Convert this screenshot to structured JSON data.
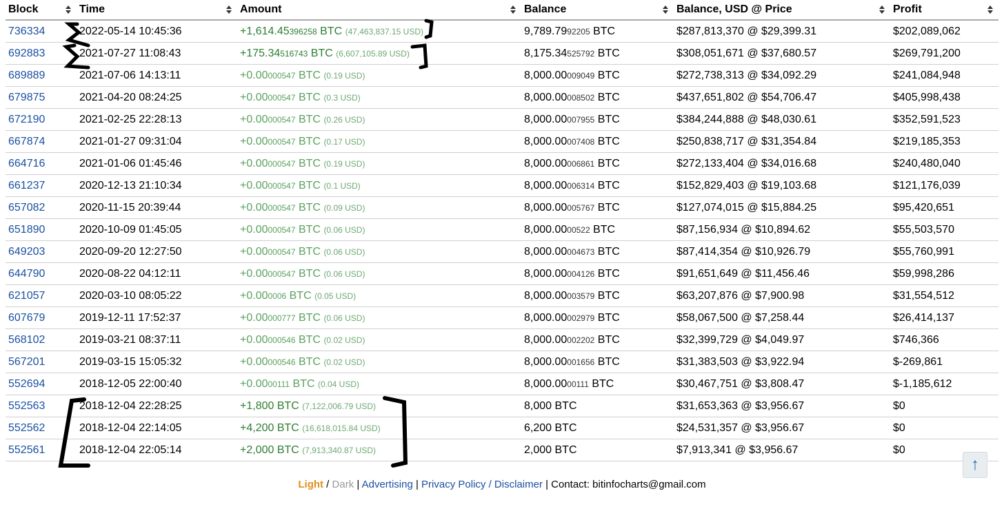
{
  "columns": [
    "Block",
    "Time",
    "Amount",
    "Balance",
    "Balance, USD @ Price",
    "Profit"
  ],
  "rows": [
    {
      "block": "736334",
      "time": "2022-05-14 10:45:36",
      "amt_main": "+1,614.45",
      "amt_frac": "396258",
      "amt_unit": " BTC",
      "amt_usd": "(47,463,837.15 USD)",
      "bal_main": "9,789.79",
      "bal_frac": "92205",
      "bal_unit": " BTC",
      "usd": "$287,813,370 @ $29,399.31",
      "profit": "$202,089,062"
    },
    {
      "block": "692883",
      "time": "2021-07-27 11:08:43",
      "amt_main": "+175.34",
      "amt_frac": "516743",
      "amt_unit": " BTC",
      "amt_usd": "(6,607,105.89 USD)",
      "bal_main": "8,175.34",
      "bal_frac": "525792",
      "bal_unit": " BTC",
      "usd": "$308,051,671 @ $37,680.57",
      "profit": "$269,791,200"
    },
    {
      "block": "689889",
      "time": "2021-07-06 14:13:11",
      "amt_main": "+0.00",
      "amt_frac": "000547",
      "amt_unit": " BTC",
      "amt_usd": "(0.19 USD)",
      "bal_main": "8,000.00",
      "bal_frac": "009049",
      "bal_unit": " BTC",
      "usd": "$272,738,313 @ $34,092.29",
      "profit": "$241,084,948"
    },
    {
      "block": "679875",
      "time": "2021-04-20 08:24:25",
      "amt_main": "+0.00",
      "amt_frac": "000547",
      "amt_unit": " BTC",
      "amt_usd": "(0.3 USD)",
      "bal_main": "8,000.00",
      "bal_frac": "008502",
      "bal_unit": " BTC",
      "usd": "$437,651,802 @ $54,706.47",
      "profit": "$405,998,438"
    },
    {
      "block": "672190",
      "time": "2021-02-25 22:28:13",
      "amt_main": "+0.00",
      "amt_frac": "000547",
      "amt_unit": " BTC",
      "amt_usd": "(0.26 USD)",
      "bal_main": "8,000.00",
      "bal_frac": "007955",
      "bal_unit": " BTC",
      "usd": "$384,244,888 @ $48,030.61",
      "profit": "$352,591,523"
    },
    {
      "block": "667874",
      "time": "2021-01-27 09:31:04",
      "amt_main": "+0.00",
      "amt_frac": "000547",
      "amt_unit": " BTC",
      "amt_usd": "(0.17 USD)",
      "bal_main": "8,000.00",
      "bal_frac": "007408",
      "bal_unit": " BTC",
      "usd": "$250,838,717 @ $31,354.84",
      "profit": "$219,185,353"
    },
    {
      "block": "664716",
      "time": "2021-01-06 01:45:46",
      "amt_main": "+0.00",
      "amt_frac": "000547",
      "amt_unit": " BTC",
      "amt_usd": "(0.19 USD)",
      "bal_main": "8,000.00",
      "bal_frac": "006861",
      "bal_unit": " BTC",
      "usd": "$272,133,404 @ $34,016.68",
      "profit": "$240,480,040"
    },
    {
      "block": "661237",
      "time": "2020-12-13 21:10:34",
      "amt_main": "+0.00",
      "amt_frac": "000547",
      "amt_unit": " BTC",
      "amt_usd": "(0.1 USD)",
      "bal_main": "8,000.00",
      "bal_frac": "006314",
      "bal_unit": " BTC",
      "usd": "$152,829,403 @ $19,103.68",
      "profit": "$121,176,039"
    },
    {
      "block": "657082",
      "time": "2020-11-15 20:39:44",
      "amt_main": "+0.00",
      "amt_frac": "000547",
      "amt_unit": " BTC",
      "amt_usd": "(0.09 USD)",
      "bal_main": "8,000.00",
      "bal_frac": "005767",
      "bal_unit": " BTC",
      "usd": "$127,074,015 @ $15,884.25",
      "profit": "$95,420,651"
    },
    {
      "block": "651890",
      "time": "2020-10-09 01:45:05",
      "amt_main": "+0.00",
      "amt_frac": "000547",
      "amt_unit": " BTC",
      "amt_usd": "(0.06 USD)",
      "bal_main": "8,000.00",
      "bal_frac": "00522",
      "bal_unit": " BTC",
      "usd": "$87,156,934 @ $10,894.62",
      "profit": "$55,503,570"
    },
    {
      "block": "649203",
      "time": "2020-09-20 12:27:50",
      "amt_main": "+0.00",
      "amt_frac": "000547",
      "amt_unit": " BTC",
      "amt_usd": "(0.06 USD)",
      "bal_main": "8,000.00",
      "bal_frac": "004673",
      "bal_unit": " BTC",
      "usd": "$87,414,354 @ $10,926.79",
      "profit": "$55,760,991"
    },
    {
      "block": "644790",
      "time": "2020-08-22 04:12:11",
      "amt_main": "+0.00",
      "amt_frac": "000547",
      "amt_unit": " BTC",
      "amt_usd": "(0.06 USD)",
      "bal_main": "8,000.00",
      "bal_frac": "004126",
      "bal_unit": " BTC",
      "usd": "$91,651,649 @ $11,456.46",
      "profit": "$59,998,286"
    },
    {
      "block": "621057",
      "time": "2020-03-10 08:05:22",
      "amt_main": "+0.00",
      "amt_frac": "0006",
      "amt_unit": " BTC",
      "amt_usd": "(0.05 USD)",
      "bal_main": "8,000.00",
      "bal_frac": "003579",
      "bal_unit": " BTC",
      "usd": "$63,207,876 @ $7,900.98",
      "profit": "$31,554,512"
    },
    {
      "block": "607679",
      "time": "2019-12-11 17:52:37",
      "amt_main": "+0.00",
      "amt_frac": "000777",
      "amt_unit": " BTC",
      "amt_usd": "(0.06 USD)",
      "bal_main": "8,000.00",
      "bal_frac": "002979",
      "bal_unit": " BTC",
      "usd": "$58,067,500 @ $7,258.44",
      "profit": "$26,414,137"
    },
    {
      "block": "568102",
      "time": "2019-03-21 08:37:11",
      "amt_main": "+0.00",
      "amt_frac": "000546",
      "amt_unit": " BTC",
      "amt_usd": "(0.02 USD)",
      "bal_main": "8,000.00",
      "bal_frac": "002202",
      "bal_unit": " BTC",
      "usd": "$32,399,729 @ $4,049.97",
      "profit": "$746,366"
    },
    {
      "block": "567201",
      "time": "2019-03-15 15:05:32",
      "amt_main": "+0.00",
      "amt_frac": "000546",
      "amt_unit": " BTC",
      "amt_usd": "(0.02 USD)",
      "bal_main": "8,000.00",
      "bal_frac": "001656",
      "bal_unit": " BTC",
      "usd": "$31,383,503 @ $3,922.94",
      "profit": "$-269,861"
    },
    {
      "block": "552694",
      "time": "2018-12-05 22:00:40",
      "amt_main": "+0.00",
      "amt_frac": "00111",
      "amt_unit": " BTC",
      "amt_usd": "(0.04 USD)",
      "bal_main": "8,000.00",
      "bal_frac": "00111",
      "bal_unit": " BTC",
      "usd": "$30,467,751 @ $3,808.47",
      "profit": "$-1,185,612"
    },
    {
      "block": "552563",
      "time": "2018-12-04 22:28:25",
      "amt_main": "+1,800",
      "amt_frac": "",
      "amt_unit": " BTC",
      "amt_usd": "(7,122,006.79 USD)",
      "bal_main": "8,000",
      "bal_frac": "",
      "bal_unit": " BTC",
      "usd": "$31,653,363 @ $3,956.67",
      "profit": "$0"
    },
    {
      "block": "552562",
      "time": "2018-12-04 22:14:05",
      "amt_main": "+4,200",
      "amt_frac": "",
      "amt_unit": " BTC",
      "amt_usd": "(16,618,015.84 USD)",
      "bal_main": "6,200",
      "bal_frac": "",
      "bal_unit": " BTC",
      "usd": "$24,531,357 @ $3,956.67",
      "profit": "$0"
    },
    {
      "block": "552561",
      "time": "2018-12-04 22:05:14",
      "amt_main": "+2,000",
      "amt_frac": "",
      "amt_unit": " BTC",
      "amt_usd": "(7,913,340.87 USD)",
      "bal_main": "2,000",
      "bal_frac": "",
      "bal_unit": " BTC",
      "usd": "$7,913,341 @ $3,956.67",
      "profit": "$0"
    }
  ],
  "footer": {
    "light": "Light",
    "sep1": " / ",
    "dark": "Dark",
    "sep2": " | ",
    "advertising": "Advertising",
    "sep3": " | ",
    "privacy": "Privacy Policy / Disclaimer",
    "sep4": " | ",
    "contact": "Contact: bitinfocharts@gmail.com"
  },
  "back_to_top": "↑",
  "colors": {
    "link": "#1a4fa0",
    "amount": "#2e7d32",
    "accent": "#e0901a"
  }
}
